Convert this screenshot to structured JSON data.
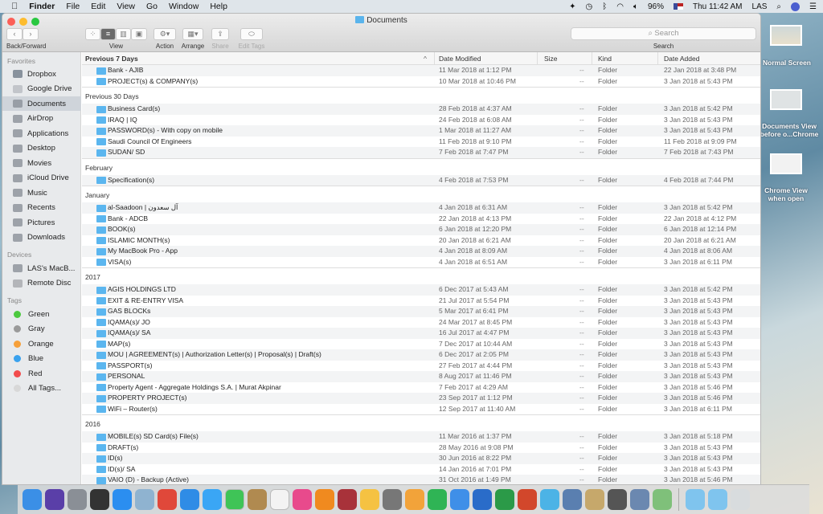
{
  "menubar": {
    "app": "Finder",
    "items": [
      "File",
      "Edit",
      "View",
      "Go",
      "Window",
      "Help"
    ],
    "battery": "96%",
    "clock": "Thu 11:42 AM",
    "user": "LAS"
  },
  "window": {
    "title": "Documents"
  },
  "toolbar": {
    "back_forward": "Back/Forward",
    "view": "View",
    "action": "Action",
    "arrange": "Arrange",
    "share": "Share",
    "edit_tags": "Edit Tags",
    "search_placeholder": "Search",
    "search_label": "Search"
  },
  "sidebar": {
    "favorites_label": "Favorites",
    "favorites": [
      {
        "label": "Dropbox",
        "icon": "dropbox-icon"
      },
      {
        "label": "Google Drive",
        "icon": "folder-icon"
      },
      {
        "label": "Documents",
        "icon": "documents-icon",
        "selected": true
      },
      {
        "label": "AirDrop",
        "icon": "airdrop-icon"
      },
      {
        "label": "Applications",
        "icon": "applications-icon"
      },
      {
        "label": "Desktop",
        "icon": "desktop-icon"
      },
      {
        "label": "Movies",
        "icon": "movies-icon"
      },
      {
        "label": "iCloud Drive",
        "icon": "cloud-icon"
      },
      {
        "label": "Music",
        "icon": "music-icon"
      },
      {
        "label": "Recents",
        "icon": "recents-icon"
      },
      {
        "label": "Pictures",
        "icon": "pictures-icon"
      },
      {
        "label": "Downloads",
        "icon": "downloads-icon"
      }
    ],
    "devices_label": "Devices",
    "devices": [
      {
        "label": "LAS's MacB...",
        "icon": "laptop-icon"
      },
      {
        "label": "Remote Disc",
        "icon": "disc-icon"
      }
    ],
    "tags_label": "Tags",
    "tags": [
      {
        "label": "Green",
        "color": "#4cc93f"
      },
      {
        "label": "Gray",
        "color": "#9a9a9a"
      },
      {
        "label": "Orange",
        "color": "#f6a03a"
      },
      {
        "label": "Blue",
        "color": "#3aa2ee"
      },
      {
        "label": "Red",
        "color": "#f24c4c"
      },
      {
        "label": "All Tags...",
        "color": "#d8d8d8"
      }
    ]
  },
  "columns": {
    "name": "Previous 7 Days",
    "date_modified": "Date Modified",
    "size": "Size",
    "kind": "Kind",
    "date_added": "Date Added"
  },
  "groups": [
    {
      "label": "Previous 7 Days",
      "rows": [
        [
          "Bank - AJIB",
          "11 Mar 2018 at 1:12 PM",
          "--",
          "Folder",
          "22 Jan 2018 at 3:48 PM"
        ],
        [
          "PROJECT(s) & COMPANY(s)",
          "10 Mar 2018 at 10:46 PM",
          "--",
          "Folder",
          "3 Jan 2018 at 5:43 PM"
        ]
      ]
    },
    {
      "label": "Previous 30 Days",
      "rows": [
        [
          "Business Card(s)",
          "28 Feb 2018 at 4:37 AM",
          "--",
          "Folder",
          "3 Jan 2018 at 5:42 PM"
        ],
        [
          "IRAQ | IQ",
          "24 Feb 2018 at 6:08 AM",
          "--",
          "Folder",
          "3 Jan 2018 at 5:43 PM"
        ],
        [
          "PASSWORD(s) - With copy on mobile",
          "1 Mar 2018 at 11:27 AM",
          "--",
          "Folder",
          "3 Jan 2018 at 5:43 PM"
        ],
        [
          "Saudi Council Of Engineers",
          "11 Feb 2018 at 9:10 PM",
          "--",
          "Folder",
          "11 Feb 2018 at 9:09 PM"
        ],
        [
          "SUDAN/ SD",
          "7 Feb 2018 at 7:47 PM",
          "--",
          "Folder",
          "7 Feb 2018 at 7:43 PM"
        ]
      ]
    },
    {
      "label": "February",
      "rows": [
        [
          "Specification(s)",
          "4 Feb 2018 at 7:53 PM",
          "--",
          "Folder",
          "4 Feb 2018 at 7:44 PM"
        ]
      ]
    },
    {
      "label": "January",
      "rows": [
        [
          "al-Saadoon | آل سعدون",
          "4 Jan 2018 at 6:31 AM",
          "--",
          "Folder",
          "3 Jan 2018 at 5:42 PM"
        ],
        [
          "Bank - ADCB",
          "22 Jan 2018 at 4:13 PM",
          "--",
          "Folder",
          "22 Jan 2018 at 4:12 PM"
        ],
        [
          "BOOK(s)",
          "6 Jan 2018 at 12:20 PM",
          "--",
          "Folder",
          "6 Jan 2018 at 12:14 PM"
        ],
        [
          "ISLAMIC MONTH(s)",
          "20 Jan 2018 at 6:21 AM",
          "--",
          "Folder",
          "20 Jan 2018 at 6:21 AM"
        ],
        [
          "My MacBook Pro - App",
          "4 Jan 2018 at 8:09 AM",
          "--",
          "Folder",
          "4 Jan 2018 at 8:06 AM"
        ],
        [
          "VISA(s)",
          "4 Jan 2018 at 6:51 AM",
          "--",
          "Folder",
          "3 Jan 2018 at 6:11 PM"
        ]
      ]
    },
    {
      "label": "2017",
      "rows": [
        [
          "AGIS HOLDINGS LTD",
          "6 Dec 2017 at 5:43 AM",
          "--",
          "Folder",
          "3 Jan 2018 at 5:42 PM"
        ],
        [
          "EXIT & RE-ENTRY VISA",
          "21 Jul 2017 at 5:54 PM",
          "--",
          "Folder",
          "3 Jan 2018 at 5:43 PM"
        ],
        [
          "GAS BLOCKs",
          "5 Mar 2017 at 6:41 PM",
          "--",
          "Folder",
          "3 Jan 2018 at 5:43 PM"
        ],
        [
          "IQAMA(s)/ JO",
          "24 Mar 2017 at 8:45 PM",
          "--",
          "Folder",
          "3 Jan 2018 at 5:43 PM"
        ],
        [
          "IQAMA(s)/ SA",
          "16 Jul 2017 at 4:47 PM",
          "--",
          "Folder",
          "3 Jan 2018 at 5:43 PM"
        ],
        [
          "MAP(s)",
          "7 Dec 2017 at 10:44 AM",
          "--",
          "Folder",
          "3 Jan 2018 at 5:43 PM"
        ],
        [
          "MOU | AGREEMENT(s) | Authorization Letter(s) | Proposal(s) | Draft(s)",
          "6 Dec 2017 at 2:05 PM",
          "--",
          "Folder",
          "3 Jan 2018 at 5:43 PM"
        ],
        [
          "PASSPORT(s)",
          "27 Feb 2017 at 4:44 PM",
          "--",
          "Folder",
          "3 Jan 2018 at 5:43 PM"
        ],
        [
          "PERSONAL",
          "8 Aug 2017 at 11:46 PM",
          "--",
          "Folder",
          "3 Jan 2018 at 5:43 PM"
        ],
        [
          "Property Agent - Aggregate Holdings S.A. | Murat Akpinar",
          "7 Feb 2017 at 4:29 AM",
          "--",
          "Folder",
          "3 Jan 2018 at 5:46 PM"
        ],
        [
          "PROPERTY PROJECT(s)",
          "23 Sep 2017 at 1:12 PM",
          "--",
          "Folder",
          "3 Jan 2018 at 5:46 PM"
        ],
        [
          "WiFi – Router(s)",
          "12 Sep 2017 at 11:40 AM",
          "--",
          "Folder",
          "3 Jan 2018 at 6:11 PM"
        ]
      ]
    },
    {
      "label": "2016",
      "rows": [
        [
          "MOBILE(s) SD Card(s) File(s)",
          "11 Mar 2016 at 1:37 PM",
          "--",
          "Folder",
          "3 Jan 2018 at 5:18 PM"
        ],
        [
          "DRAFT(s)",
          "28 May 2016 at 9:08 PM",
          "--",
          "Folder",
          "3 Jan 2018 at 5:43 PM"
        ],
        [
          "ID(s)",
          "30 Jun 2016 at 8:22 PM",
          "--",
          "Folder",
          "3 Jan 2018 at 5:43 PM"
        ],
        [
          "ID(s)/ SA",
          "14 Jan 2016 at 7:01 PM",
          "--",
          "Folder",
          "3 Jan 2018 at 5:43 PM"
        ],
        [
          "VAIO (D) - Backup (Active)",
          "31 Oct 2016 at 1:49 PM",
          "--",
          "Folder",
          "3 Jan 2018 at 5:46 PM"
        ]
      ]
    }
  ],
  "desktop": [
    {
      "label": "Normal Screen"
    },
    {
      "label": "Documents View before o...Chrome"
    },
    {
      "label": "Chrome View when open"
    }
  ],
  "dock": [
    {
      "icon": "finder-icon",
      "color": "#3b8fe6"
    },
    {
      "icon": "siri-icon",
      "color": "#5a3fa8"
    },
    {
      "icon": "launchpad-icon",
      "color": "#8a8f96"
    },
    {
      "icon": "mission-control-icon",
      "color": "#333"
    },
    {
      "icon": "app-store-icon",
      "color": "#2b8ef0"
    },
    {
      "icon": "preview-icon",
      "color": "#8fb3d0"
    },
    {
      "icon": "chrome-icon",
      "color": "#e0483a"
    },
    {
      "icon": "safari-icon",
      "color": "#2f8ce6"
    },
    {
      "icon": "messages-icon",
      "color": "#3aa6f5"
    },
    {
      "icon": "facetime-icon",
      "color": "#3fc457"
    },
    {
      "icon": "notes-icon",
      "color": "#b08a50"
    },
    {
      "icon": "calendar-icon",
      "color": "#f3f3f3"
    },
    {
      "icon": "itunes-icon",
      "color": "#e84a8c"
    },
    {
      "icon": "ibooks-icon",
      "color": "#f08a1f"
    },
    {
      "icon": "photo-booth-icon",
      "color": "#a8323a"
    },
    {
      "icon": "photos-icon",
      "color": "#f5c242"
    },
    {
      "icon": "system-preferences-icon",
      "color": "#777"
    },
    {
      "icon": "pages-icon",
      "color": "#f2a33a"
    },
    {
      "icon": "numbers-icon",
      "color": "#2fb455"
    },
    {
      "icon": "keynote-icon",
      "color": "#3f8fe8"
    },
    {
      "icon": "word-icon",
      "color": "#2a6cc9"
    },
    {
      "icon": "excel-icon",
      "color": "#2b9a48"
    },
    {
      "icon": "powerpoint-icon",
      "color": "#d2472b"
    },
    {
      "icon": "messenger-icon",
      "color": "#4cb3e6"
    },
    {
      "icon": "migration-icon",
      "color": "#5a7fb0"
    },
    {
      "icon": "utility-icon",
      "color": "#c6a86b"
    },
    {
      "icon": "printer-icon",
      "color": "#555"
    },
    {
      "icon": "hp-icon",
      "color": "#6b88b0"
    },
    {
      "icon": "maps-icon",
      "color": "#7fc07a"
    },
    {
      "icon": "downloads-stack-icon",
      "color": "#7fc4ee"
    },
    {
      "icon": "documents-stack-icon",
      "color": "#7fc4ee"
    },
    {
      "icon": "trash-icon",
      "color": "#d8dcde"
    }
  ]
}
